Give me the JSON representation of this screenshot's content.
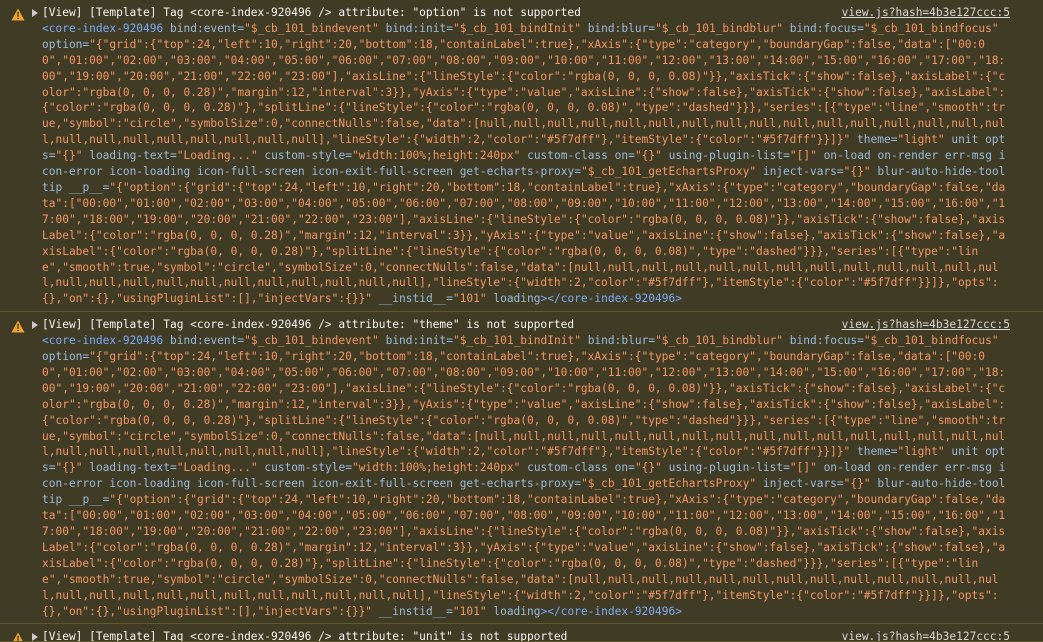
{
  "console": {
    "messages": [
      {
        "level": "warning",
        "head": "[View] [Template] Tag <core-index-920496 /> attribute: \"option\" is not supported",
        "source": "view.js?hash=4b3e127ccc:5"
      },
      {
        "level": "warning",
        "head": "[View] [Template] Tag <core-index-920496 /> attribute: \"theme\" is not supported",
        "source": "view.js?hash=4b3e127ccc:5"
      },
      {
        "level": "warning",
        "head": "[View] [Template] Tag <core-index-920496 /> attribute: \"unit\" is not supported",
        "source": "view.js?hash=4b3e127ccc:5"
      }
    ],
    "element": {
      "open_tag": "<core-index-920496",
      "close_tag": "></core-index-920496>",
      "attributes": [
        {
          "name": "bind:event",
          "value": "\"$_cb_101_bindevent\""
        },
        {
          "name": "bind:init",
          "value": "\"$_cb_101_bindInit\""
        },
        {
          "name": "bind:blur",
          "value": "\"$_cb_101_bindblur\""
        },
        {
          "name": "bind:focus",
          "value": "\"$_cb_101_bindfocus\""
        },
        {
          "name": "option",
          "value": "\"{\"grid\":{\"top\":24,\"left\":10,\"right\":20,\"bottom\":18,\"containLabel\":true},\"xAxis\":{\"type\":\"category\",\"boundaryGap\":false,\"data\":[\"00:00\",\"01:00\",\"02:00\",\"03:00\",\"04:00\",\"05:00\",\"06:00\",\"07:00\",\"08:00\",\"09:00\",\"10:00\",\"11:00\",\"12:00\",\"13:00\",\"14:00\",\"15:00\",\"16:00\",\"17:00\",\"18:00\",\"19:00\",\"20:00\",\"21:00\",\"22:00\",\"23:00\"],\"axisLine\":{\"lineStyle\":{\"color\":\"rgba(0, 0, 0, 0.08)\"}},\"axisTick\":{\"show\":false},\"axisLabel\":{\"color\":\"rgba(0, 0, 0, 0.28)\",\"margin\":12,\"interval\":3}},\"yAxis\":{\"type\":\"value\",\"axisLine\":{\"show\":false},\"axisTick\":{\"show\":false},\"axisLabel\":{\"color\":\"rgba(0, 0, 0, 0.28)\"},\"splitLine\":{\"lineStyle\":{\"color\":\"rgba(0, 0, 0, 0.08)\",\"type\":\"dashed\"}}},\"series\":[{\"type\":\"line\",\"smooth\":true,\"symbol\":\"circle\",\"symbolSize\":0,\"connectNulls\":false,\"data\":[null,null,null,null,null,null,null,null,null,null,null,null,null,null,null,null,null,null,null,null,null,null,null,null],\"lineStyle\":{\"width\":2,\"color\":\"#5f7dff\"},\"itemStyle\":{\"color\":\"#5f7dff\"}}]}\""
        },
        {
          "name": "theme",
          "value": "\"light\""
        },
        {
          "name": "unit",
          "value": ""
        },
        {
          "name": "opts",
          "value": "\"{}\""
        },
        {
          "name": "loading-text",
          "value": "\"Loading...\""
        },
        {
          "name": "custom-style",
          "value": "\"width:100%;height:240px\""
        },
        {
          "name": "custom-class",
          "value": ""
        },
        {
          "name": "on",
          "value": "\"{}\""
        },
        {
          "name": "using-plugin-list",
          "value": "\"[]\""
        },
        {
          "name": "on-load",
          "value": ""
        },
        {
          "name": "on-render",
          "value": ""
        },
        {
          "name": "err-msg",
          "value": ""
        },
        {
          "name": "icon-error",
          "value": ""
        },
        {
          "name": "icon-loading",
          "value": ""
        },
        {
          "name": "icon-full-screen",
          "value": ""
        },
        {
          "name": "icon-exit-full-screen",
          "value": ""
        },
        {
          "name": "get-echarts-proxy",
          "value": "\"$_cb_101_getEchartsProxy\""
        },
        {
          "name": "inject-vars",
          "value": "\"{}\""
        },
        {
          "name": "blur-auto-hide-tooltip",
          "value": ""
        },
        {
          "name": "__p__",
          "value": "\"{\"option\":{\"grid\":{\"top\":24,\"left\":10,\"right\":20,\"bottom\":18,\"containLabel\":true},\"xAxis\":{\"type\":\"category\",\"boundaryGap\":false,\"data\":[\"00:00\",\"01:00\",\"02:00\",\"03:00\",\"04:00\",\"05:00\",\"06:00\",\"07:00\",\"08:00\",\"09:00\",\"10:00\",\"11:00\",\"12:00\",\"13:00\",\"14:00\",\"15:00\",\"16:00\",\"17:00\",\"18:00\",\"19:00\",\"20:00\",\"21:00\",\"22:00\",\"23:00\"],\"axisLine\":{\"lineStyle\":{\"color\":\"rgba(0, 0, 0, 0.08)\"}},\"axisTick\":{\"show\":false},\"axisLabel\":{\"color\":\"rgba(0, 0, 0, 0.28)\",\"margin\":12,\"interval\":3}},\"yAxis\":{\"type\":\"value\",\"axisLine\":{\"show\":false},\"axisTick\":{\"show\":false},\"axisLabel\":{\"color\":\"rgba(0, 0, 0, 0.28)\"},\"splitLine\":{\"lineStyle\":{\"color\":\"rgba(0, 0, 0, 0.08)\",\"type\":\"dashed\"}}},\"series\":[{\"type\":\"line\",\"smooth\":true,\"symbol\":\"circle\",\"symbolSize\":0,\"connectNulls\":false,\"data\":[null,null,null,null,null,null,null,null,null,null,null,null,null,null,null,null,null,null,null,null,null,null,null,null],\"lineStyle\":{\"width\":2,\"color\":\"#5f7dff\"},\"itemStyle\":{\"color\":\"#5f7dff\"}}]},\"opts\":{},\"on\":{},\"usingPluginList\":[],\"injectVars\":{}}\""
        },
        {
          "name": "__instid__",
          "value": "\"101\""
        },
        {
          "name": "loading",
          "value": ""
        }
      ]
    }
  },
  "colors": {
    "background": "#3b3726",
    "message_bg": "#403b24",
    "separator": "#5e5a2e",
    "warning_icon": "#f0a332",
    "tag_text": "#7cacf8",
    "attribute_name": "#9bbbdc",
    "attribute_value": "#f29766"
  },
  "icons": {
    "message_icon": "warning-triangle-icon",
    "expand_icon": "disclosure-triangle-icon"
  }
}
